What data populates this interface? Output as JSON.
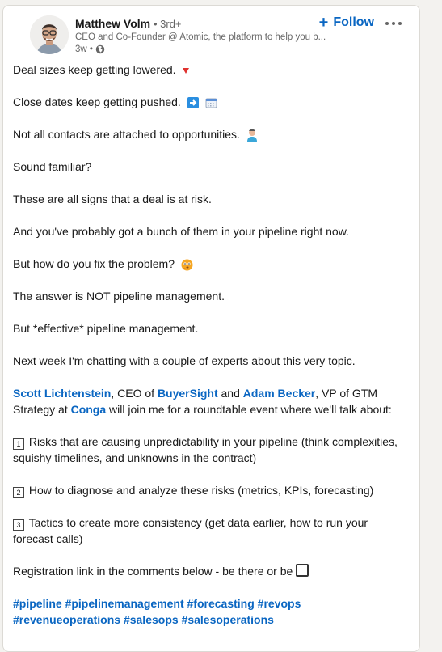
{
  "post": {
    "author": {
      "name": "Matthew Volm",
      "degree": "• 3rd+",
      "headline": "CEO and Co-Founder @ Atomic, the platform to help you b...",
      "time": "3w •",
      "avatar_icon": "profile-photo",
      "visibility_icon": "globe-icon"
    },
    "follow_label": "Follow",
    "follow_icon": "+",
    "more_icon": "ellipsis-icon",
    "paragraphs": {
      "p1": "Deal sizes keep getting lowered.",
      "p2": "Close dates keep getting pushed.",
      "p3": "Not all contacts are attached to opportunities.",
      "p4": "Sound familiar?",
      "p5": "These are all signs that a deal is at risk.",
      "p6": "And you've probably got a bunch of them in your pipeline right now.",
      "p7": "But how do you fix the problem?",
      "p8": "The answer is NOT pipeline management.",
      "p9": "But *effective* pipeline management.",
      "p10": "Next week I'm chatting with a couple of experts about this very topic.",
      "registration": "Registration link in the comments below - be there or be"
    },
    "mentions_paragraph": {
      "person1": "Scott Lichtenstein",
      "text1": ", CEO of ",
      "company1": "BuyerSight",
      "text2": " and ",
      "person2": "Adam Becker",
      "text3": ", VP of GTM Strategy at ",
      "company2": "Conga",
      "text4": " will join me for a roundtable event where we'll talk about:"
    },
    "list": [
      {
        "num": "1",
        "text": "Risks that are causing unpredictability in your pipeline (think complexities, squishy timelines, and unknowns in the contract)"
      },
      {
        "num": "2",
        "text": "How to diagnose and analyze these risks (metrics, KPIs, forecasting)"
      },
      {
        "num": "3",
        "text": "Tactics to create more consistency (get data earlier, how to run your forecast calls)"
      }
    ],
    "hashtags": [
      "#pipeline",
      "#pipelinemanagement",
      "#forecasting",
      "#revops",
      "#revenueoperations",
      "#salesops",
      "#salesoperations"
    ],
    "emojis": {
      "p1": "red-down-triangle",
      "p2a": "right-arrow",
      "p2b": "calendar",
      "p3": "person",
      "p7": "thinking-face",
      "registration": "empty-square"
    }
  },
  "colors": {
    "link": "#0a66c2",
    "text": "#191919",
    "muted": "#666666",
    "background": "#f3f2ef"
  }
}
